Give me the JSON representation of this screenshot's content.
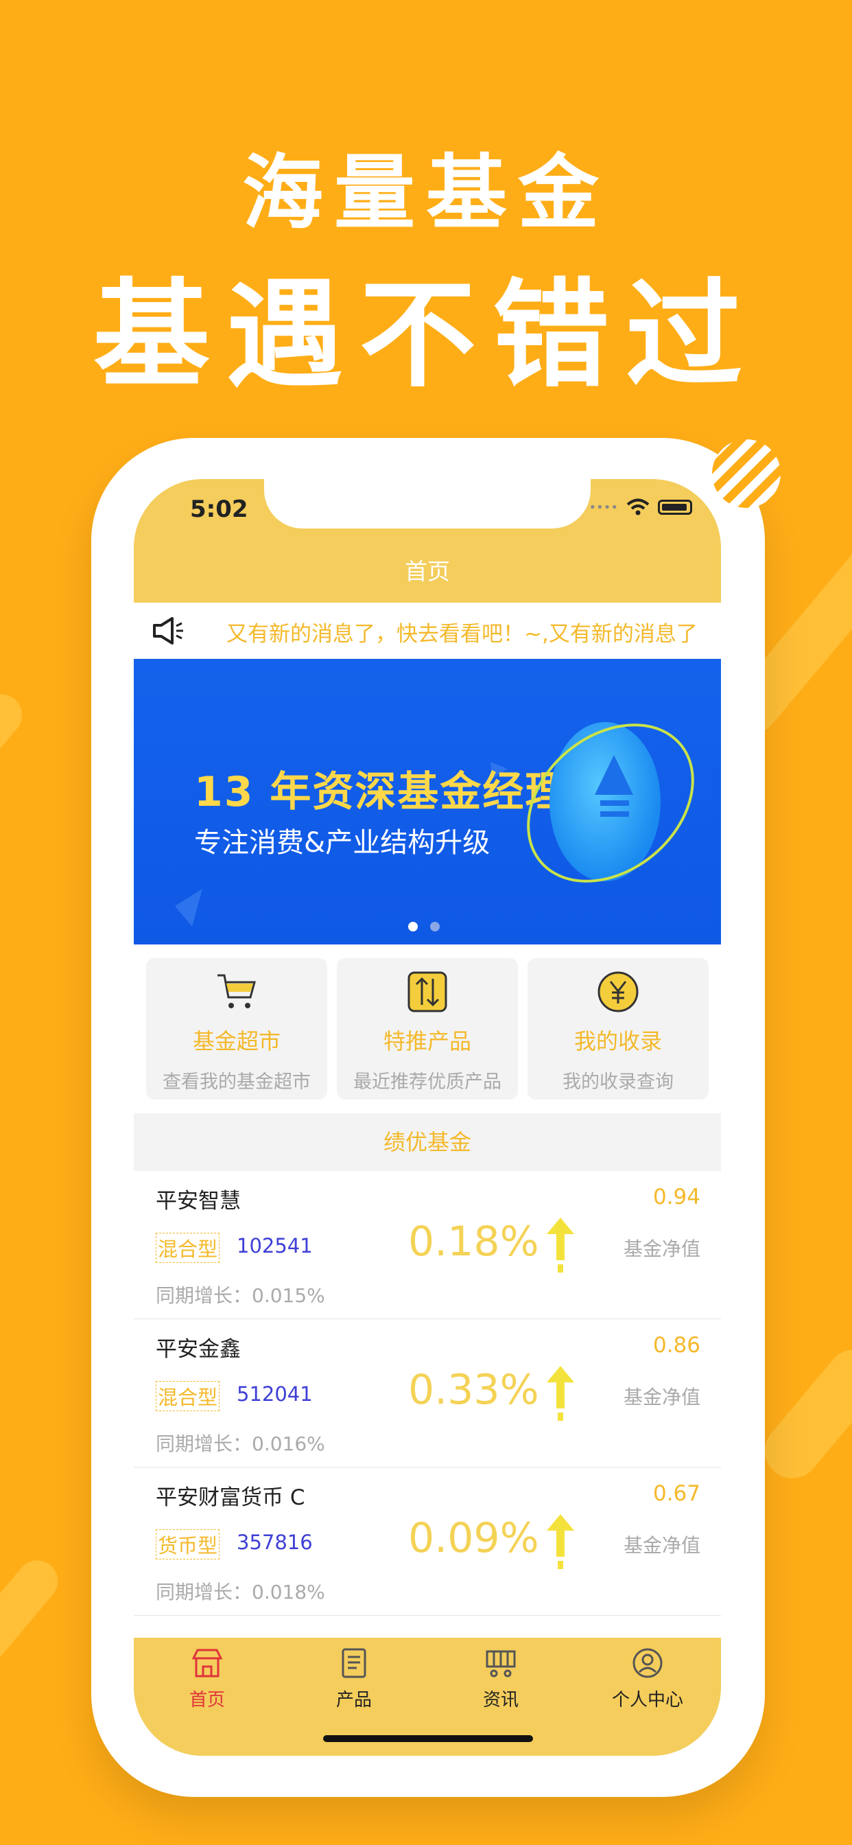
{
  "promo": {
    "headline1": "海量基金",
    "headline2": "基遇不错过"
  },
  "status_bar": {
    "time": "5:02"
  },
  "nav": {
    "title": "首页"
  },
  "notice": {
    "text": "又有新的消息了，快去看看吧！~,又有新的消息了"
  },
  "banner": {
    "title": "13 年资深基金经理",
    "subtitle": "专注消费&产业结构升级",
    "pages": 2,
    "active_page": 1
  },
  "quick_links": [
    {
      "label": "基金超市",
      "sub": "查看我的基金超市",
      "icon": "cart-icon"
    },
    {
      "label": "特推产品",
      "sub": "最近推荐优质产品",
      "icon": "swap-arrows-icon"
    },
    {
      "label": "我的收录",
      "sub": "我的收录查询",
      "icon": "yen-icon"
    }
  ],
  "section": {
    "title": "绩优基金"
  },
  "funds": [
    {
      "name": "平安智慧",
      "nav": "0.94",
      "type": "混合型",
      "code": "102541",
      "rate": "0.18%",
      "nav_label": "基金净值",
      "growth": "同期增长：0.015%"
    },
    {
      "name": "平安金鑫",
      "nav": "0.86",
      "type": "混合型",
      "code": "512041",
      "rate": "0.33%",
      "nav_label": "基金净值",
      "growth": "同期增长：0.016%"
    },
    {
      "name": "平安财富货币 C",
      "nav": "0.67",
      "type": "货币型",
      "code": "357816",
      "rate": "0.09%",
      "nav_label": "基金净值",
      "growth": "同期增长：0.018%"
    }
  ],
  "tabs": [
    {
      "label": "首页",
      "icon": "shop-icon",
      "active": true
    },
    {
      "label": "产品",
      "icon": "document-icon",
      "active": false
    },
    {
      "label": "资讯",
      "icon": "cart-news-icon",
      "active": false
    },
    {
      "label": "个人中心",
      "icon": "user-icon",
      "active": false
    }
  ],
  "colors": {
    "background": "#ffad17",
    "header": "#f4cd5c",
    "accent": "#f4b92b",
    "banner": "#1462eb",
    "code": "#3f3fd6",
    "active_tab": "#e0343c"
  }
}
